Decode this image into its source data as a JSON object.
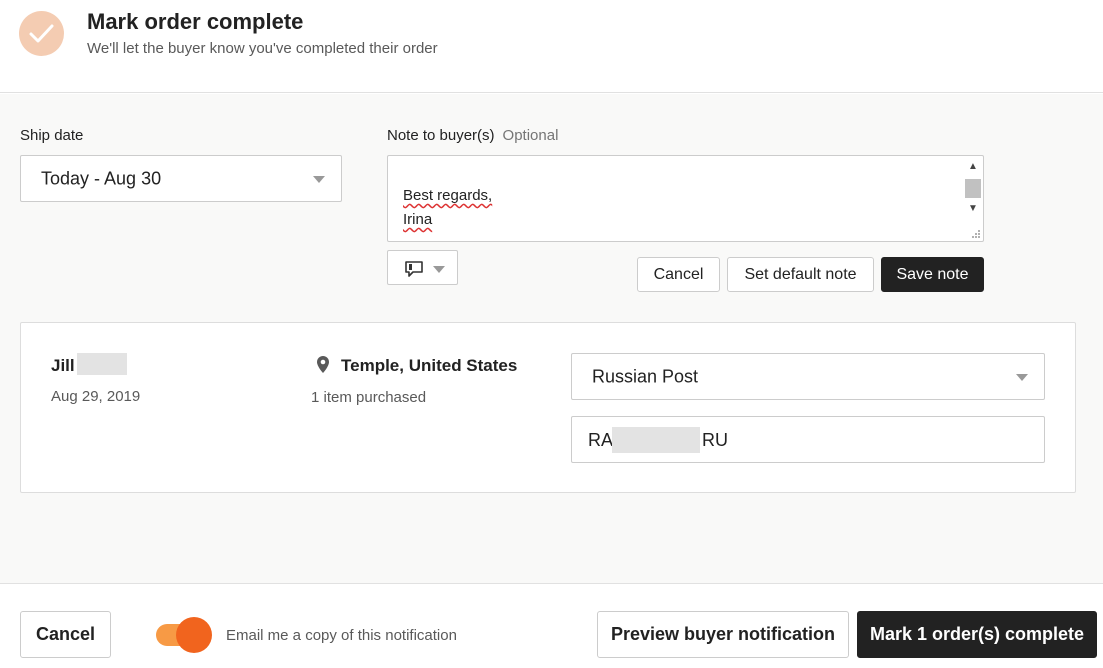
{
  "header": {
    "title": "Mark order complete",
    "subtitle": "We'll let the buyer know you've completed their order"
  },
  "ship": {
    "label": "Ship date",
    "value": "Today - Aug 30"
  },
  "note": {
    "label": "Note to buyer(s)",
    "optional": "Optional",
    "lines": [
      "Best regards,",
      "Irina"
    ],
    "cancel_label": "Cancel",
    "default_label": "Set default note",
    "save_label": "Save note"
  },
  "order": {
    "buyer_first": "Jill",
    "date": "Aug 29, 2019",
    "location": "Temple, United States",
    "items": "1 item purchased",
    "carrier": "Russian Post",
    "tracking_prefix": "RA",
    "tracking_suffix": "RU"
  },
  "footer": {
    "cancel_label": "Cancel",
    "email_copy_label": "Email me a copy of this notification",
    "email_copy_on": true,
    "preview_label": "Preview buyer notification",
    "complete_label": "Mark 1 order(s) complete"
  },
  "colors": {
    "accent": "#f1641e",
    "toggle_track": "#f79a45",
    "check_circle": "#f4ccb2",
    "dark_button": "#222222"
  }
}
